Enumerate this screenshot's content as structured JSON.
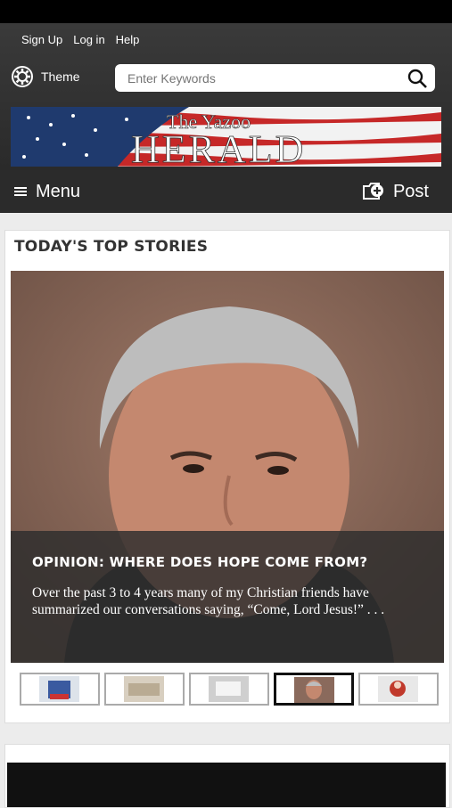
{
  "topnav": {
    "links": [
      "Sign Up",
      "Log in",
      "Help"
    ],
    "theme_label": "Theme",
    "search_placeholder": "Enter Keywords"
  },
  "banner": {
    "title_small": "The Yazoo",
    "title_large": "HERALD"
  },
  "menubar": {
    "menu_label": "Menu",
    "post_label": "Post"
  },
  "top_stories": {
    "heading": "TODAY'S TOP STORIES",
    "featured": {
      "title": "OPINION: WHERE DOES HOPE COME FROM?",
      "excerpt": "Over the past 3 to 4 years many of my Christian friends have summarized our conversations saying, “Come, Lord Jesus!” . . ."
    },
    "thumbnails": [
      {
        "name": "thumb-1",
        "active": false
      },
      {
        "name": "thumb-2",
        "active": false
      },
      {
        "name": "thumb-3",
        "active": false
      },
      {
        "name": "thumb-4",
        "active": true
      },
      {
        "name": "thumb-5",
        "active": false
      }
    ]
  },
  "colors": {
    "nav_bg": "#2b2b2b",
    "overlay_bg": "#2d2d2d",
    "page_bg": "#ececec"
  }
}
